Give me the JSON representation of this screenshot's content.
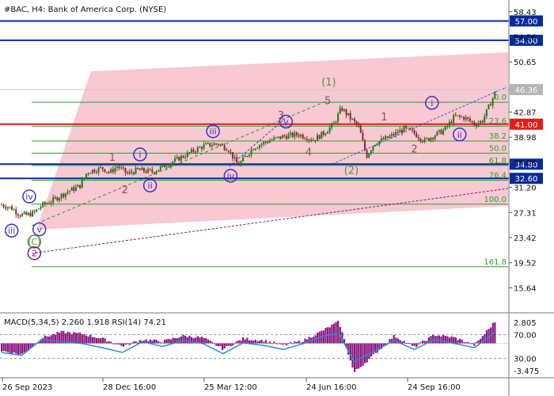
{
  "header": {
    "symbol_line": "#BAC, H4:  Bank of America Corp. (NYSE)"
  },
  "colors": {
    "up_candle": "#1e7a1e",
    "down_candle": "#8a2a2a",
    "channel_fill": "#f8c9d2",
    "fib_line": "#2f9e2f",
    "level_line": "#0a2a9a",
    "resistance_line": "#e31b1b",
    "current_price_badge": "#b5b5b5",
    "wave_blue": "#3a2fc9",
    "wave_brown": "#9a4a4a",
    "wave_green": "#5f8a3c",
    "wave_purple": "#7a1a7a",
    "macd_hist": "#8a167f",
    "rsi_line": "#2a8adf"
  },
  "chart_data": {
    "type": "candlestick",
    "instrument": "Bank of America Corp. (NYSE)",
    "timeframe": "H4",
    "price_axis": {
      "ylim": [
        12,
        60
      ],
      "ticks": [
        58.43,
        54.56,
        50.65,
        46.36,
        42.87,
        38.98,
        35.08,
        31.2,
        27.31,
        23.42,
        19.52,
        15.64
      ]
    },
    "x_ticks": [
      "26 Sep 2023",
      "28 Dec 16:00",
      "25 Mar 12:00",
      "24 Jun 16:00",
      "24 Sep 16:00"
    ],
    "current_price": 46.36,
    "levels": [
      {
        "value": 57.0,
        "label": "57.00",
        "kind": "target"
      },
      {
        "value": 54.0,
        "label": "54.00",
        "kind": "target"
      },
      {
        "value": 41.0,
        "label": "41.00",
        "kind": "resistance"
      },
      {
        "value": 34.8,
        "label": "34.80",
        "kind": "support"
      },
      {
        "value": 32.6,
        "label": "32.60",
        "kind": "support"
      }
    ],
    "fibonacci": [
      {
        "ratio": "0.0",
        "price": 44.4
      },
      {
        "ratio": "23.6",
        "price": 40.7
      },
      {
        "ratio": "38.2",
        "price": 38.4
      },
      {
        "ratio": "50.0",
        "price": 36.5
      },
      {
        "ratio": "61.8",
        "price": 34.6
      },
      {
        "ratio": "76.4",
        "price": 32.3
      },
      {
        "ratio": "100.0",
        "price": 28.6
      },
      {
        "ratio": "161.8",
        "price": 18.9
      }
    ],
    "price_series": [
      {
        "t": 0.0,
        "p": 28.5
      },
      {
        "t": 0.02,
        "p": 28.0
      },
      {
        "t": 0.035,
        "p": 27.0
      },
      {
        "t": 0.05,
        "p": 26.9
      },
      {
        "t": 0.065,
        "p": 27.3
      },
      {
        "t": 0.08,
        "p": 28.4
      },
      {
        "t": 0.1,
        "p": 29.1
      },
      {
        "t": 0.13,
        "p": 30.5
      },
      {
        "t": 0.155,
        "p": 31.4
      },
      {
        "t": 0.17,
        "p": 33.6
      },
      {
        "t": 0.2,
        "p": 34.2
      },
      {
        "t": 0.215,
        "p": 33.5
      },
      {
        "t": 0.23,
        "p": 34.5
      },
      {
        "t": 0.25,
        "p": 33.3
      },
      {
        "t": 0.27,
        "p": 33.9
      },
      {
        "t": 0.3,
        "p": 33.6
      },
      {
        "t": 0.32,
        "p": 34.4
      },
      {
        "t": 0.35,
        "p": 35.6
      },
      {
        "t": 0.37,
        "p": 36.4
      },
      {
        "t": 0.4,
        "p": 37.6
      },
      {
        "t": 0.43,
        "p": 38.0
      },
      {
        "t": 0.45,
        "p": 37.2
      },
      {
        "t": 0.47,
        "p": 34.6
      },
      {
        "t": 0.5,
        "p": 37.4
      },
      {
        "t": 0.53,
        "p": 38.4
      },
      {
        "t": 0.56,
        "p": 39.1
      },
      {
        "t": 0.59,
        "p": 39.4
      },
      {
        "t": 0.62,
        "p": 38.6
      },
      {
        "t": 0.64,
        "p": 39.6
      },
      {
        "t": 0.66,
        "p": 41.0
      },
      {
        "t": 0.675,
        "p": 43.5
      },
      {
        "t": 0.69,
        "p": 42.2
      },
      {
        "t": 0.71,
        "p": 40.5
      },
      {
        "t": 0.725,
        "p": 36.0
      },
      {
        "t": 0.74,
        "p": 38.0
      },
      {
        "t": 0.77,
        "p": 39.0
      },
      {
        "t": 0.8,
        "p": 40.3
      },
      {
        "t": 0.82,
        "p": 39.6
      },
      {
        "t": 0.84,
        "p": 38.4
      },
      {
        "t": 0.86,
        "p": 39.3
      },
      {
        "t": 0.88,
        "p": 40.1
      },
      {
        "t": 0.9,
        "p": 42.2
      },
      {
        "t": 0.92,
        "p": 42.0
      },
      {
        "t": 0.94,
        "p": 41.0
      },
      {
        "t": 0.955,
        "p": 41.5
      },
      {
        "t": 0.97,
        "p": 44.0
      },
      {
        "t": 0.98,
        "p": 45.8
      }
    ],
    "wave_labels": [
      {
        "text": "iii",
        "t": 0.02,
        "p": 24.5,
        "style": "circle",
        "color": "wave_blue"
      },
      {
        "text": "iv",
        "t": 0.055,
        "p": 29.8,
        "style": "circle",
        "color": "wave_blue"
      },
      {
        "text": "v",
        "t": 0.075,
        "p": 24.7,
        "style": "circle",
        "color": "wave_blue"
      },
      {
        "text": "(C)",
        "t": 0.065,
        "p": 22.8,
        "style": "circle",
        "color": "wave_green"
      },
      {
        "text": "2",
        "t": 0.065,
        "p": 21.0,
        "style": "circle",
        "color": "wave_purple"
      },
      {
        "text": "1",
        "t": 0.22,
        "p": 35.8,
        "style": "plain",
        "color": "wave_brown"
      },
      {
        "text": "i",
        "t": 0.275,
        "p": 36.3,
        "style": "circle",
        "color": "wave_blue"
      },
      {
        "text": "2",
        "t": 0.245,
        "p": 30.8,
        "style": "plain",
        "color": "wave_brown"
      },
      {
        "text": "ii",
        "t": 0.295,
        "p": 31.5,
        "style": "circle",
        "color": "wave_blue"
      },
      {
        "text": "iii",
        "t": 0.42,
        "p": 39.9,
        "style": "circle",
        "color": "wave_blue"
      },
      {
        "text": "iv",
        "t": 0.455,
        "p": 33.0,
        "style": "circle",
        "color": "wave_blue"
      },
      {
        "text": "3",
        "t": 0.555,
        "p": 42.3,
        "style": "plain",
        "color": "wave_brown"
      },
      {
        "text": "v",
        "t": 0.565,
        "p": 41.4,
        "style": "circle",
        "color": "wave_blue"
      },
      {
        "text": "4",
        "t": 0.61,
        "p": 36.6,
        "style": "plain",
        "color": "wave_brown"
      },
      {
        "text": "(1)",
        "t": 0.65,
        "p": 47.5,
        "style": "plain",
        "color": "wave_green"
      },
      {
        "text": "5",
        "t": 0.648,
        "p": 44.6,
        "style": "plain",
        "color": "wave_brown"
      },
      {
        "text": "(2)",
        "t": 0.695,
        "p": 33.8,
        "style": "plain",
        "color": "wave_green"
      },
      {
        "text": "1",
        "t": 0.76,
        "p": 42.1,
        "style": "plain",
        "color": "wave_brown"
      },
      {
        "text": "2",
        "t": 0.82,
        "p": 37.1,
        "style": "plain",
        "color": "wave_brown"
      },
      {
        "text": "i",
        "t": 0.855,
        "p": 44.3,
        "style": "circle",
        "color": "wave_blue"
      },
      {
        "text": "ii",
        "t": 0.91,
        "p": 39.4,
        "style": "circle",
        "color": "wave_blue"
      }
    ],
    "indicator": {
      "title": "MACD(5,34,5) 2.260 1.918 RSI(14) 74.21",
      "macd_ticks": [
        "2.805",
        "-3.475"
      ],
      "rsi_levels": [
        "70.00",
        "30.00"
      ],
      "ylim": [
        -3.475,
        2.805
      ],
      "macd_hist": [
        {
          "t": 0.0,
          "v": -0.8
        },
        {
          "t": 0.04,
          "v": -1.2
        },
        {
          "t": 0.08,
          "v": 0.6
        },
        {
          "t": 0.12,
          "v": 1.2
        },
        {
          "t": 0.16,
          "v": 1.0
        },
        {
          "t": 0.2,
          "v": 0.5
        },
        {
          "t": 0.24,
          "v": -0.3
        },
        {
          "t": 0.28,
          "v": 0.4
        },
        {
          "t": 0.32,
          "v": 0.2
        },
        {
          "t": 0.36,
          "v": 0.8
        },
        {
          "t": 0.4,
          "v": 0.6
        },
        {
          "t": 0.44,
          "v": -0.6
        },
        {
          "t": 0.48,
          "v": 0.5
        },
        {
          "t": 0.52,
          "v": 0.3
        },
        {
          "t": 0.56,
          "v": -0.2
        },
        {
          "t": 0.6,
          "v": 0.3
        },
        {
          "t": 0.64,
          "v": 1.4
        },
        {
          "t": 0.67,
          "v": 2.3
        },
        {
          "t": 0.7,
          "v": -3.1
        },
        {
          "t": 0.74,
          "v": -1.2
        },
        {
          "t": 0.78,
          "v": 0.8
        },
        {
          "t": 0.82,
          "v": -0.4
        },
        {
          "t": 0.86,
          "v": 0.9
        },
        {
          "t": 0.9,
          "v": 0.6
        },
        {
          "t": 0.94,
          "v": -0.2
        },
        {
          "t": 0.98,
          "v": 2.3
        }
      ],
      "rsi_line": [
        {
          "t": 0.0,
          "v": 40
        },
        {
          "t": 0.04,
          "v": 35
        },
        {
          "t": 0.08,
          "v": 62
        },
        {
          "t": 0.12,
          "v": 58
        },
        {
          "t": 0.16,
          "v": 55
        },
        {
          "t": 0.2,
          "v": 48
        },
        {
          "t": 0.24,
          "v": 40
        },
        {
          "t": 0.28,
          "v": 58
        },
        {
          "t": 0.32,
          "v": 50
        },
        {
          "t": 0.36,
          "v": 60
        },
        {
          "t": 0.4,
          "v": 55
        },
        {
          "t": 0.44,
          "v": 38
        },
        {
          "t": 0.48,
          "v": 56
        },
        {
          "t": 0.52,
          "v": 52
        },
        {
          "t": 0.56,
          "v": 45
        },
        {
          "t": 0.6,
          "v": 55
        },
        {
          "t": 0.64,
          "v": 68
        },
        {
          "t": 0.67,
          "v": 72
        },
        {
          "t": 0.7,
          "v": 25
        },
        {
          "t": 0.74,
          "v": 42
        },
        {
          "t": 0.78,
          "v": 60
        },
        {
          "t": 0.82,
          "v": 45
        },
        {
          "t": 0.86,
          "v": 62
        },
        {
          "t": 0.9,
          "v": 55
        },
        {
          "t": 0.94,
          "v": 48
        },
        {
          "t": 0.98,
          "v": 74
        }
      ]
    }
  }
}
